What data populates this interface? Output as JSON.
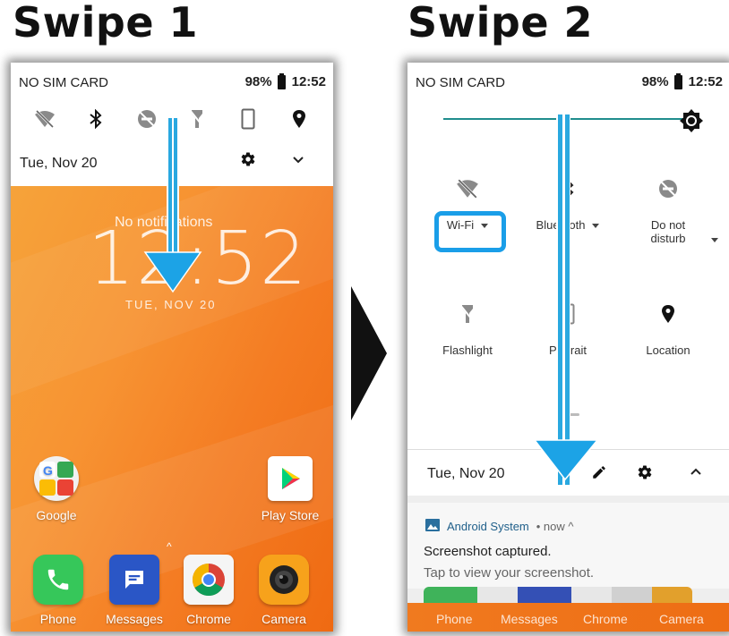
{
  "headings": {
    "left": "Swipe 1",
    "right": "Swipe 2"
  },
  "phone1": {
    "status": {
      "carrier": "NO SIM CARD",
      "battery": "98%",
      "time": "12:52"
    },
    "quick_icons": [
      "wifi-off-icon",
      "bluetooth-icon",
      "do-not-disturb-icon",
      "flashlight-off-icon",
      "portrait-icon",
      "location-icon"
    ],
    "date": "Tue, Nov 20",
    "lockscreen": {
      "no_notifications": "No notifications",
      "clock": "12:52",
      "date": "TUE, NOV 20"
    },
    "apps": {
      "google": "Google",
      "play_store": "Play Store",
      "phone": "Phone",
      "messages": "Messages",
      "chrome": "Chrome",
      "camera": "Camera"
    }
  },
  "phone2": {
    "status": {
      "carrier": "NO SIM CARD",
      "battery": "98%",
      "time": "12:52"
    },
    "tiles": {
      "wifi": "Wi-Fi",
      "bluetooth": "Bluetooth",
      "dnd_line1": "Do not",
      "dnd_line2": "disturb",
      "flashlight": "Flashlight",
      "portrait": "Portrait",
      "location": "Location"
    },
    "date": "Tue, Nov 20",
    "notification": {
      "app": "Android System",
      "meta": "• now ^",
      "title": "Screenshot captured.",
      "text": "Tap to view your screenshot."
    },
    "dock": {
      "phone": "Phone",
      "messages": "Messages",
      "chrome": "Chrome",
      "camera": "Camera"
    }
  },
  "colors": {
    "accent_blue": "#1a9ee8",
    "wallpaper_orange": "#f47c23",
    "slider_teal": "#1f8d8d"
  }
}
